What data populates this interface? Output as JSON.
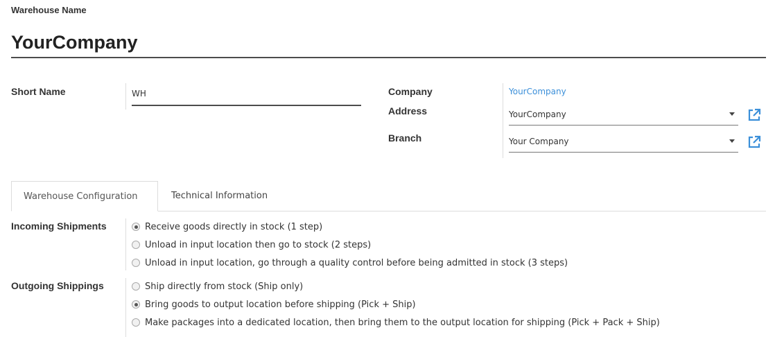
{
  "header": {
    "warehouse_name_label": "Warehouse Name",
    "warehouse_name_value": "YourCompany"
  },
  "short_name": {
    "label": "Short Name",
    "value": "WH"
  },
  "company": {
    "label": "Company",
    "value": "YourCompany"
  },
  "address": {
    "label": "Address",
    "value": "YourCompany"
  },
  "branch": {
    "label": "Branch",
    "value": "Your Company"
  },
  "tabs": [
    {
      "label": "Warehouse Configuration",
      "active": true
    },
    {
      "label": "Technical Information",
      "active": false
    }
  ],
  "incoming": {
    "label": "Incoming Shipments",
    "options": [
      {
        "label": "Receive goods directly in stock (1 step)",
        "checked": true
      },
      {
        "label": "Unload in input location then go to stock (2 steps)",
        "checked": false
      },
      {
        "label": "Unload in input location, go through a quality control before being admitted in stock (3 steps)",
        "checked": false
      }
    ]
  },
  "outgoing": {
    "label": "Outgoing Shippings",
    "options": [
      {
        "label": "Ship directly from stock (Ship only)",
        "checked": false
      },
      {
        "label": "Bring goods to output location before shipping (Pick + Ship)",
        "checked": true
      },
      {
        "label": "Make packages into a dedicated location, then bring them to the output location for shipping (Pick + Pack + Ship)",
        "checked": false
      }
    ]
  },
  "colors": {
    "link": "#3b8fd9",
    "text": "#333333",
    "border": "#dcdcdc"
  },
  "icons": {
    "external_link": "external-link-icon",
    "dropdown": "caret-down-icon"
  }
}
